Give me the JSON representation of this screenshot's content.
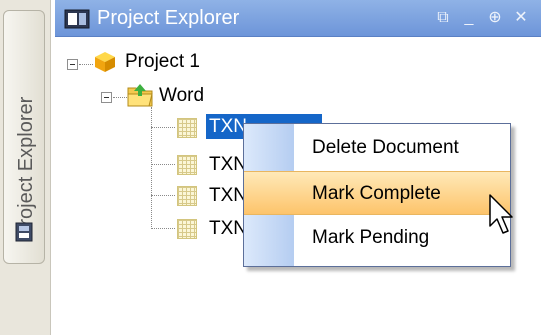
{
  "side_tab": {
    "label": "Project Explorer",
    "icon": "panel-icon"
  },
  "panel": {
    "title": "Project Explorer",
    "icon": "panel-icon",
    "controls": [
      "restore-icon",
      "minimize-icon",
      "pin-icon",
      "close-icon"
    ]
  },
  "tree": {
    "project": {
      "label": "Project 1",
      "icon": "project-cube-icon"
    },
    "folder": {
      "label": "Word",
      "icon": "folder-icon"
    },
    "documents": [
      {
        "label": "TXN",
        "selected": true
      },
      {
        "label": "TXN",
        "selected": false
      },
      {
        "label": "TXN",
        "selected": false
      },
      {
        "label": "TXN",
        "selected": false
      }
    ]
  },
  "context_menu": {
    "items": [
      {
        "label": "Delete Document"
      },
      {
        "label": "Mark Complete",
        "hovered": true
      },
      {
        "label": "Mark Pending"
      }
    ]
  },
  "colors": {
    "titlebar": "#7aa0df",
    "selection": "#1566c8",
    "menu_hover": "#fdc46b",
    "menu_gutter": "#c6d9f5"
  }
}
